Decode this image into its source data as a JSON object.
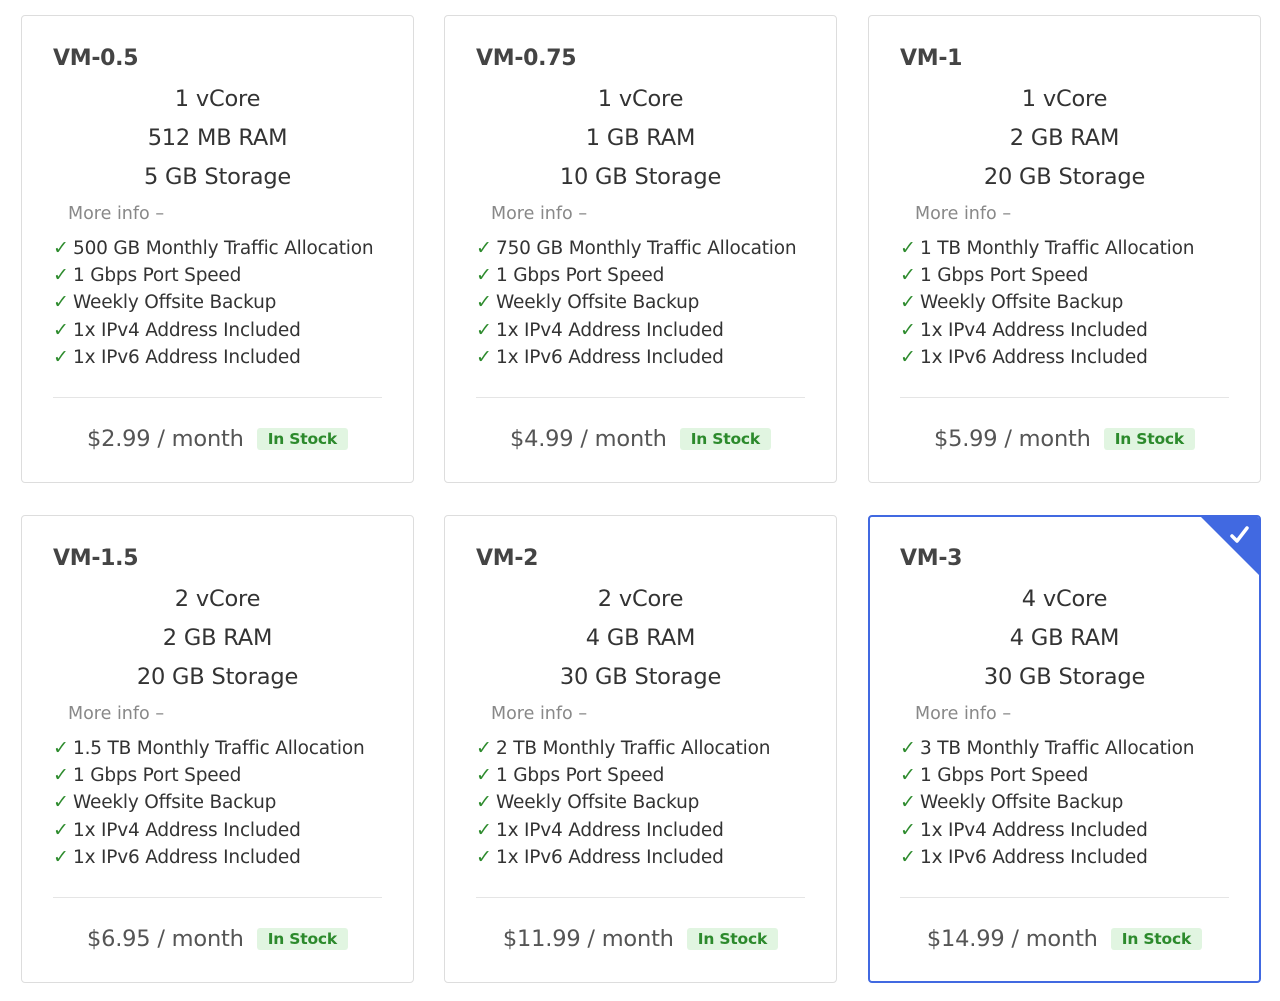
{
  "colors": {
    "selected_border": "#4169e1",
    "check": "#2e8b2e",
    "badge_bg": "#e1f5e1",
    "badge_text": "#2c8a2c"
  },
  "plans": [
    {
      "name": "VM-0.5",
      "specs": [
        "1 vCore",
        "512 MB RAM",
        "5 GB Storage"
      ],
      "more_info": "More info –",
      "features": [
        "500 GB Monthly Traffic Allocation",
        "1 Gbps Port Speed",
        "Weekly Offsite Backup",
        "1x IPv4 Address Included",
        "1x IPv6 Address Included"
      ],
      "price": "$2.99 / month",
      "stock": "In Stock",
      "selected": false
    },
    {
      "name": "VM-0.75",
      "specs": [
        "1 vCore",
        "1 GB RAM",
        "10 GB Storage"
      ],
      "more_info": "More info –",
      "features": [
        "750 GB Monthly Traffic Allocation",
        "1 Gbps Port Speed",
        "Weekly Offsite Backup",
        "1x IPv4 Address Included",
        "1x IPv6 Address Included"
      ],
      "price": "$4.99 / month",
      "stock": "In Stock",
      "selected": false
    },
    {
      "name": "VM-1",
      "specs": [
        "1 vCore",
        "2 GB RAM",
        "20 GB Storage"
      ],
      "more_info": "More info –",
      "features": [
        "1 TB Monthly Traffic Allocation",
        "1 Gbps Port Speed",
        "Weekly Offsite Backup",
        "1x IPv4 Address Included",
        "1x IPv6 Address Included"
      ],
      "price": "$5.99 / month",
      "stock": "In Stock",
      "selected": false
    },
    {
      "name": "VM-1.5",
      "specs": [
        "2 vCore",
        "2 GB RAM",
        "20 GB Storage"
      ],
      "more_info": "More info –",
      "features": [
        "1.5 TB Monthly Traffic Allocation",
        "1 Gbps Port Speed",
        "Weekly Offsite Backup",
        "1x IPv4 Address Included",
        "1x IPv6 Address Included"
      ],
      "price": "$6.95 / month",
      "stock": "In Stock",
      "selected": false
    },
    {
      "name": "VM-2",
      "specs": [
        "2 vCore",
        "4 GB RAM",
        "30 GB Storage"
      ],
      "more_info": "More info –",
      "features": [
        "2 TB Monthly Traffic Allocation",
        "1 Gbps Port Speed",
        "Weekly Offsite Backup",
        "1x IPv4 Address Included",
        "1x IPv6 Address Included"
      ],
      "price": "$11.99 / month",
      "stock": "In Stock",
      "selected": false
    },
    {
      "name": "VM-3",
      "specs": [
        "4 vCore",
        "4 GB RAM",
        "30 GB Storage"
      ],
      "more_info": "More info –",
      "features": [
        "3 TB Monthly Traffic Allocation",
        "1 Gbps Port Speed",
        "Weekly Offsite Backup",
        "1x IPv4 Address Included",
        "1x IPv6 Address Included"
      ],
      "price": "$14.99 / month",
      "stock": "In Stock",
      "selected": true
    }
  ]
}
